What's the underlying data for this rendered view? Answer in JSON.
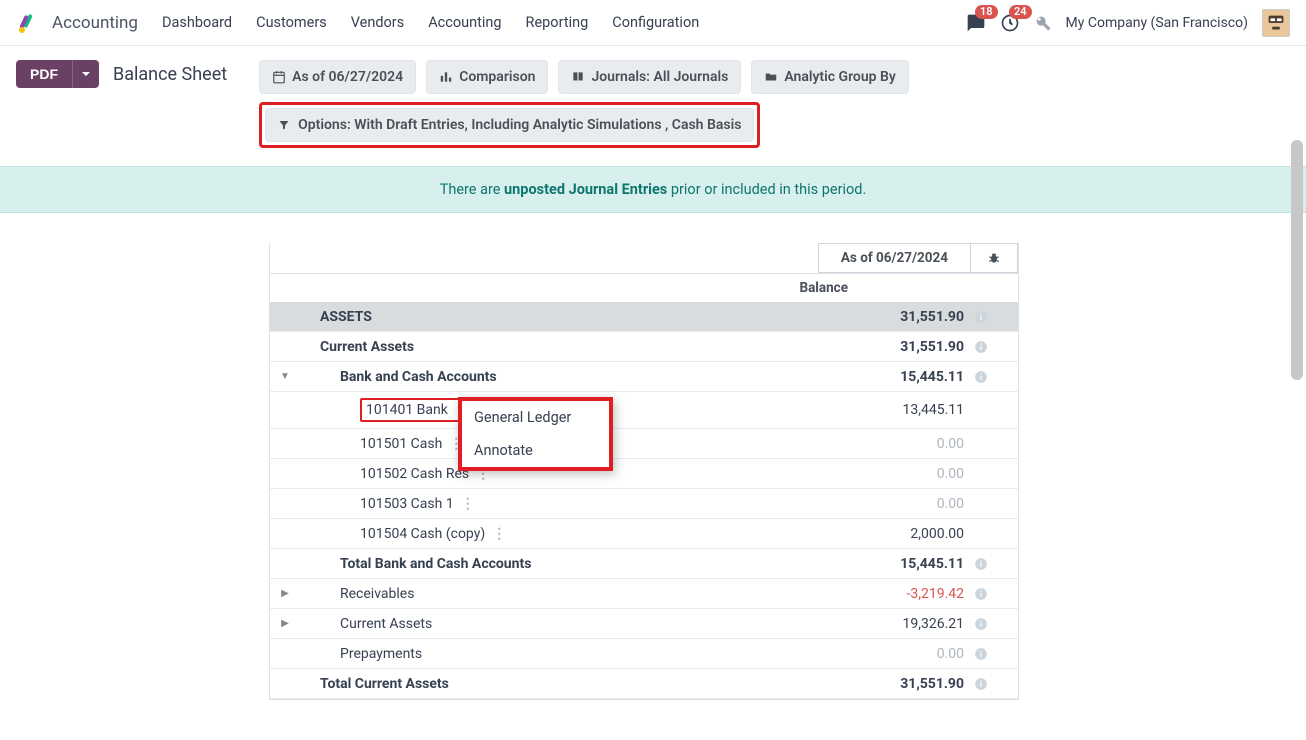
{
  "header": {
    "app_name": "Accounting",
    "nav": [
      "Dashboard",
      "Customers",
      "Vendors",
      "Accounting",
      "Reporting",
      "Configuration"
    ],
    "badges": {
      "chat": "18",
      "clock": "24"
    },
    "company": "My Company (San Francisco)"
  },
  "pdf_label": "PDF",
  "page_title": "Balance Sheet",
  "filters": {
    "asof": "As of 06/27/2024",
    "comparison": "Comparison",
    "journals": "Journals: All Journals",
    "analytic": "Analytic Group By",
    "options": "Options: With Draft Entries, Including Analytic Simulations , Cash Basis"
  },
  "alert": {
    "pre": "There are ",
    "bold": "unposted Journal Entries",
    "post": " prior or included in this period."
  },
  "report": {
    "header_date": "As of 06/27/2024",
    "balance_label": "Balance",
    "rows": [
      {
        "type": "section",
        "label": "ASSETS",
        "amount": "31,551.90",
        "info": true,
        "indent": 1
      },
      {
        "type": "bold",
        "label": "Current Assets",
        "amount": "31,551.90",
        "info": true,
        "indent": 1
      },
      {
        "type": "bold",
        "label": "Bank and Cash Accounts",
        "amount": "15,445.11",
        "info": true,
        "indent": 2,
        "caret": "down"
      },
      {
        "type": "acct",
        "label": "101401 Bank",
        "amount": "13,445.11",
        "indent": 3,
        "highlight": true,
        "popup": true
      },
      {
        "type": "acct",
        "label": "101501 Cash",
        "amount": "0.00",
        "muted": true,
        "indent": 3
      },
      {
        "type": "acct",
        "label": "101502 Cash Res",
        "amount": "0.00",
        "muted": true,
        "indent": 3,
        "truncated": true
      },
      {
        "type": "acct",
        "label": "101503 Cash 1",
        "amount": "0.00",
        "muted": true,
        "indent": 3
      },
      {
        "type": "acct",
        "label": "101504 Cash (copy)",
        "amount": "2,000.00",
        "indent": 3
      },
      {
        "type": "bold",
        "label": "Total Bank and Cash Accounts",
        "amount": "15,445.11",
        "info": true,
        "indent": 2
      },
      {
        "type": "plain",
        "label": "Receivables",
        "amount": "-3,219.42",
        "neg": true,
        "info": true,
        "indent": 2,
        "caret": "right"
      },
      {
        "type": "plain",
        "label": "Current Assets",
        "amount": "19,326.21",
        "info": true,
        "indent": 2,
        "caret": "right"
      },
      {
        "type": "plain",
        "label": "Prepayments",
        "amount": "0.00",
        "muted": true,
        "info": true,
        "indent": 2
      },
      {
        "type": "bold",
        "label": "Total Current Assets",
        "amount": "31,551.90",
        "info": true,
        "indent": 1
      }
    ],
    "popup_items": [
      "General Ledger",
      "Annotate"
    ]
  }
}
